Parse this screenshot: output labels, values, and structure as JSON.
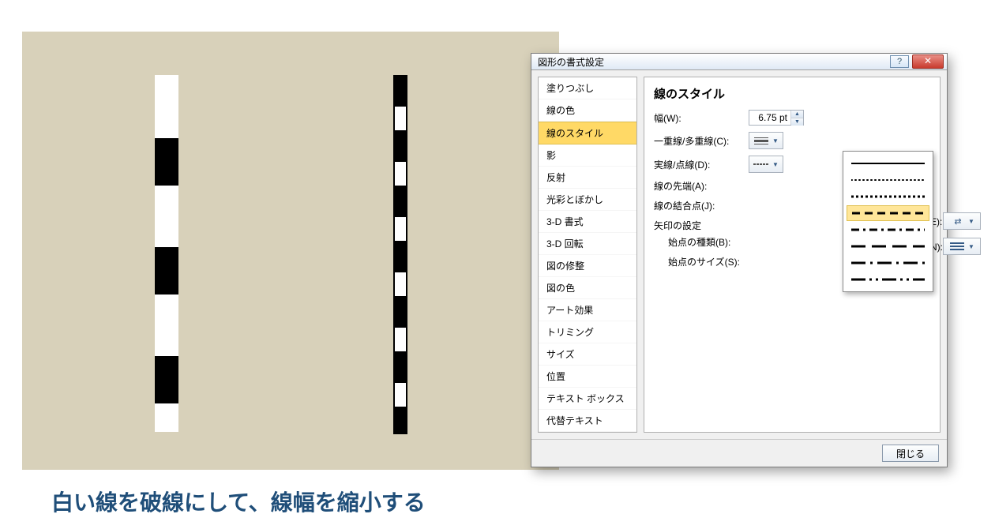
{
  "canvas": {},
  "caption": "白い線を破線にして、線幅を縮小する",
  "dialog": {
    "title": "図形の書式設定",
    "help_symbol": "?",
    "close_symbol": "✕",
    "sidebar": {
      "items": [
        "塗りつぶし",
        "線の色",
        "線のスタイル",
        "影",
        "反射",
        "光彩とぼかし",
        "3-D 書式",
        "3-D 回転",
        "図の修整",
        "図の色",
        "アート効果",
        "トリミング",
        "サイズ",
        "位置",
        "テキスト ボックス",
        "代替テキスト"
      ],
      "selected_index": 2
    },
    "panel": {
      "heading": "線のスタイル",
      "fields": {
        "width_label": "幅(W):",
        "width_value": "6.75 pt",
        "compound_label": "一重線/多重線(C):",
        "dash_label": "実線/点線(D):",
        "cap_label": "線の先端(A):",
        "join_label": "線の結合点(J):",
        "arrow_heading": "矢印の設定",
        "begin_type_label": "始点の種類(B):",
        "begin_size_label": "始点のサイズ(S):",
        "end_type_label_fragment": "頁(E):",
        "end_size_label_fragment": "ズ(N):"
      }
    },
    "footer": {
      "close_label": "閉じる"
    }
  }
}
